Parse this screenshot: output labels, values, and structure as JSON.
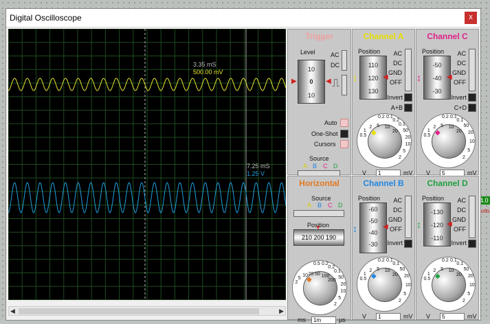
{
  "window": {
    "title": "Digital Oscilloscope",
    "close_label": "x"
  },
  "screen": {
    "cursor1": {
      "time": "3.35 mS",
      "value": "500.00 mV"
    },
    "cursor2": {
      "time": "7.25 mS",
      "value": "1.25 V"
    },
    "colors": {
      "trace_a": "#e8e830",
      "trace_b": "#20a0e0"
    }
  },
  "trigger": {
    "title": "Trigger",
    "level_label": "Level",
    "drum": [
      "10",
      "0",
      "10"
    ],
    "ac": "AC",
    "dc": "DC",
    "auto": "Auto",
    "oneshot": "One-Shot",
    "cursors": "Cursors",
    "source_label": "Source",
    "sources": [
      "A",
      "B",
      "C",
      "D"
    ]
  },
  "channel_a": {
    "title": "Channel A",
    "position_label": "Position",
    "drum": [
      "110",
      "120",
      "130"
    ],
    "modes": [
      "AC",
      "DC",
      "GND",
      "OFF"
    ],
    "invert": "Invert",
    "combine": "A+B",
    "knob_left": [
      "0.5",
      "1",
      "2",
      "5",
      "10",
      "20"
    ],
    "knob_right": [
      "0.2",
      "0.1",
      "50",
      "20",
      "10",
      "5",
      "2"
    ],
    "knob_top": [
      "0.2",
      "0.1"
    ],
    "unit_left": "V",
    "unit_value": "1",
    "unit_right": "mV",
    "color": "#e8e000"
  },
  "channel_c": {
    "title": "Channel C",
    "position_label": "Position",
    "drum": [
      "-50",
      "-40",
      "-30"
    ],
    "modes": [
      "AC",
      "DC",
      "GND",
      "OFF"
    ],
    "invert": "Invert",
    "combine": "C+D",
    "knob_left": [
      "0.5",
      "1",
      "2",
      "5",
      "10",
      "20"
    ],
    "knob_right": [
      "0.1",
      "50",
      "20",
      "10",
      "5",
      "2"
    ],
    "knob_top": [
      "0.2",
      "0.1"
    ],
    "unit_left": "V",
    "unit_value": "5",
    "unit_right": "mV",
    "color": "#e0208a"
  },
  "horizontal": {
    "title": "Horizontal",
    "source_label": "Source",
    "sources": [
      "A",
      "B",
      "C",
      "D"
    ],
    "position_label": "Position",
    "drum": [
      "210",
      "200",
      "190"
    ],
    "knob_left": [
      "2",
      "5",
      "10",
      "20",
      "50",
      "100",
      "200"
    ],
    "knob_right": [
      "0.2",
      "0.1",
      "50",
      "20",
      "10",
      "5",
      "2"
    ],
    "knob_top": [
      "0.5",
      "0.2"
    ],
    "unit_left": "ms",
    "unit_value": "1m",
    "unit_right": "µs",
    "color": "#e07820"
  },
  "channel_b": {
    "title": "Channel B",
    "position_label": "Position",
    "drum": [
      "-60",
      "-50",
      "-40",
      "-30"
    ],
    "modes": [
      "AC",
      "DC",
      "GND",
      "OFF"
    ],
    "invert": "Invert",
    "knob_left": [
      "0.5",
      "1",
      "2",
      "5",
      "10",
      "20"
    ],
    "knob_right": [
      "0.1",
      "50",
      "20",
      "10",
      "5",
      "2"
    ],
    "knob_top": [
      "0.2",
      "0.1"
    ],
    "unit_left": "V",
    "unit_value": "1",
    "unit_right": "mV",
    "color": "#2088e0"
  },
  "channel_d": {
    "title": "Channel D",
    "position_label": "Position",
    "drum": [
      "-130",
      "-120",
      "-110"
    ],
    "modes": [
      "AC",
      "DC",
      "GND",
      "OFF"
    ],
    "invert": "Invert",
    "knob_left": [
      "0.5",
      "1",
      "2",
      "5",
      "10",
      "20"
    ],
    "knob_right": [
      "0.1",
      "50",
      "20",
      "10",
      "5",
      "2"
    ],
    "knob_top": [
      "0.2",
      "0.1"
    ],
    "unit_left": "V",
    "unit_value": "5",
    "unit_right": "mV",
    "color": "#20a040"
  },
  "background": {
    "badge": "4.0",
    "side_text": "olts"
  }
}
